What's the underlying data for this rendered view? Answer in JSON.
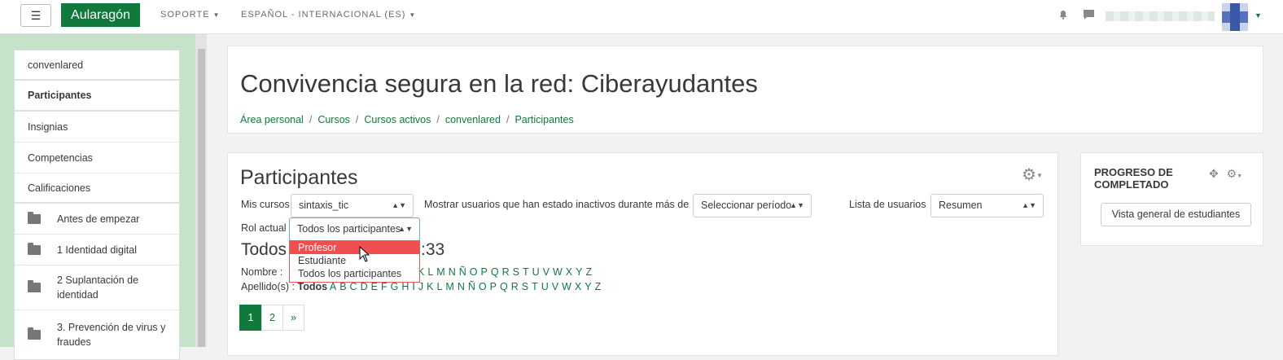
{
  "navbar": {
    "menu_icon": "hamburger-icon",
    "brand": "Aularagón",
    "support": "SOPORTE",
    "language": "ESPAÑOL - INTERNACIONAL (ES)",
    "icons": [
      "bell-icon",
      "chat-icon"
    ]
  },
  "drawer": {
    "items": [
      {
        "label": "convenlared"
      },
      {
        "label": "Participantes"
      },
      {
        "label": "Insignias"
      },
      {
        "label": "Competencias"
      },
      {
        "label": "Calificaciones"
      },
      {
        "label": "Antes de empezar"
      },
      {
        "label": "1 Identidad digital"
      },
      {
        "label": "2 Suplantación de identidad"
      },
      {
        "label": "3. Prevención de virus y fraudes"
      }
    ]
  },
  "header": {
    "title": "Convivencia segura en la red: Ciberayudantes",
    "breadcrumb": [
      "Área personal",
      "Cursos",
      "Cursos activos",
      "convenlared",
      "Participantes"
    ]
  },
  "main": {
    "heading": "Participantes",
    "mis_cursos_label": "Mis cursos",
    "mis_cursos_value": "sintaxis_tic",
    "inactive_label": "Mostrar usuarios que han estado inactivos durante más de",
    "inactive_value": "Seleccionar período",
    "user_list_label": "Lista de usuarios",
    "user_list_value": "Resumen",
    "rol_label": "Rol actual",
    "rol_value": "Todos los participantes",
    "rol_options": [
      "Profesor",
      "Estudiante",
      "Todos los participantes"
    ],
    "rol_highlighted": "Profesor",
    "todos_left": "Todos",
    "todos_right": ":33",
    "nombre_label": "Nombre :",
    "nombre_letters_visible": [
      "K",
      "L",
      "M",
      "N",
      "Ñ",
      "O",
      "P",
      "Q",
      "R",
      "S",
      "T",
      "U",
      "V",
      "W",
      "X",
      "Y",
      "Z"
    ],
    "apellido_label": "Apellido(s) :",
    "apellido_active": "Todos",
    "apellido_letters": [
      "A",
      "B",
      "C",
      "D",
      "E",
      "F",
      "G",
      "H",
      "I",
      "J",
      "K",
      "L",
      "M",
      "N",
      "Ñ",
      "O",
      "P",
      "Q",
      "R",
      "S",
      "T",
      "U",
      "V",
      "W",
      "X",
      "Y",
      "Z"
    ],
    "pagination": [
      "1",
      "2",
      "»"
    ]
  },
  "block": {
    "title": "PROGRESO DE COMPLETADO",
    "button": "Vista general de estudiantes"
  },
  "colors": {
    "brand": "#0f7a3c",
    "drawer_bg": "#c6e2c8",
    "highlight": "#ef4f4f"
  }
}
